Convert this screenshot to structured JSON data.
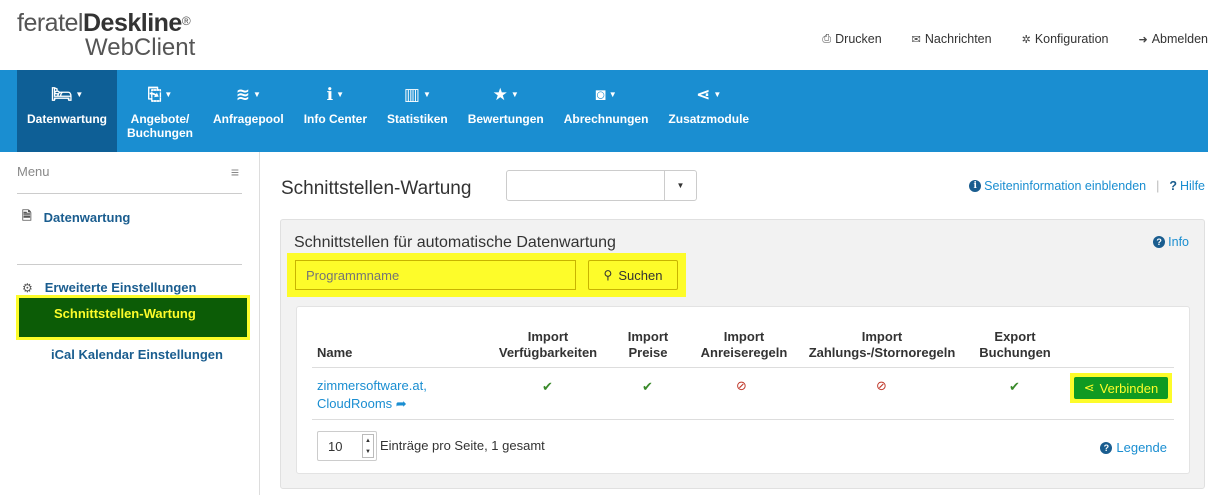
{
  "logo": {
    "line1_light": "feratel",
    "line1_bold": "Deskline",
    "reg": "®",
    "line2": "WebClient"
  },
  "toplinks": [
    {
      "icon": "print-icon",
      "glyph": "⎙",
      "label": "Drucken"
    },
    {
      "icon": "envelope-icon",
      "glyph": "✉",
      "label": "Nachrichten"
    },
    {
      "icon": "gear-icon",
      "glyph": "✲",
      "label": "Konfiguration"
    },
    {
      "icon": "sign-out-icon",
      "glyph": "➜",
      "label": "Abmelden"
    }
  ],
  "nav": [
    {
      "label": "Datenwartung",
      "label2": "",
      "icon": "bed-icon",
      "glyph": "🛏",
      "active": true
    },
    {
      "label": "Angebote/",
      "label2": "Buchungen",
      "icon": "offers-icon",
      "glyph": "⎘",
      "active": false
    },
    {
      "label": "Anfragepool",
      "label2": "",
      "icon": "inbox-icon",
      "glyph": "≋",
      "active": false
    },
    {
      "label": "Info Center",
      "label2": "",
      "icon": "info-icon",
      "glyph": "ℹ",
      "active": false
    },
    {
      "label": "Statistiken",
      "label2": "",
      "icon": "bar-chart-icon",
      "glyph": "▥",
      "active": false
    },
    {
      "label": "Bewertungen",
      "label2": "",
      "icon": "star-icon",
      "glyph": "★",
      "active": false
    },
    {
      "label": "Abrechnungen",
      "label2": "",
      "icon": "money-icon",
      "glyph": "◙",
      "active": false
    },
    {
      "label": "Zusatzmodule",
      "label2": "",
      "icon": "share-icon",
      "glyph": "⋖",
      "active": false
    }
  ],
  "sidebar": {
    "menu_label": "Menu",
    "section1": "Datenwartung",
    "section2": "Erweiterte Einstellungen",
    "active_item": "Schnittstellen-Wartung",
    "sub_item": "iCal Kalendar Einstellungen"
  },
  "main": {
    "title": "Schnittstellen-Wartung",
    "select_value": "",
    "show_info": "Seiteninformation einblenden",
    "separator": "|",
    "help": "Hilfe",
    "panel_title": "Schnittstellen für automatische Datenwartung",
    "panel_info": "Info",
    "search_placeholder": "Programmname",
    "search_button": "Suchen"
  },
  "table": {
    "headers": {
      "name": "Name",
      "avail_1": "Import",
      "avail_2": "Verfügbarkeiten",
      "price_1": "Import",
      "price_2": "Preise",
      "arrival_1": "Import",
      "arrival_2": "Anreiseregeln",
      "payment_1": "Import",
      "payment_2": "Zahlungs-/Stornoregeln",
      "export_1": "Export",
      "export_2": "Buchungen"
    },
    "row": {
      "name_line1": "zimmersoftware.at,",
      "name_line2": "CloudRooms",
      "avail": "✔",
      "price": "✔",
      "arrival": "⊘",
      "payment": "⊘",
      "export": "✔",
      "action": "Verbinden"
    }
  },
  "pager": {
    "value": "10",
    "label": "Einträge pro Seite, 1 gesamt",
    "legend": "Legende"
  },
  "colors": {
    "nav_bg": "#1a8ed1",
    "nav_active": "#0e5f96",
    "highlight": "#fdfc2a",
    "active_green": "#0c5c06",
    "link": "#1a8ed1"
  }
}
